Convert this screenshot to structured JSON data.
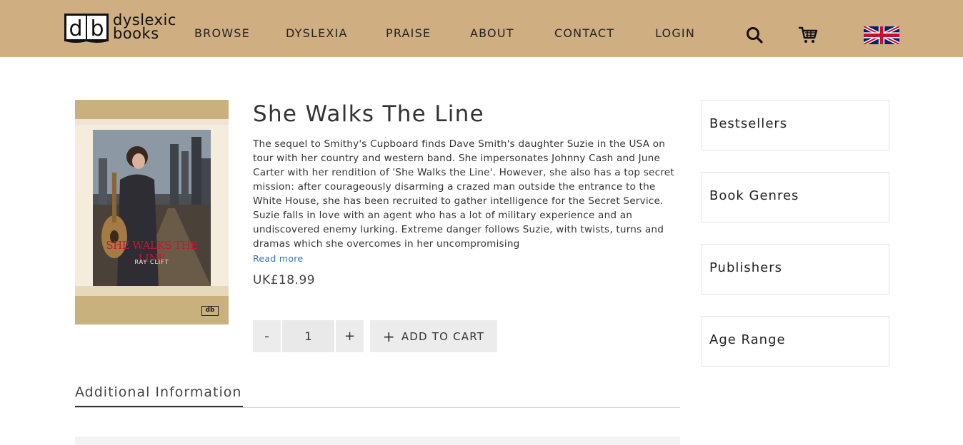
{
  "brand": {
    "mark": "db",
    "line1": "dyslexic",
    "line2": "books"
  },
  "nav": [
    {
      "label": "BROWSE"
    },
    {
      "label": "DYSLEXIA"
    },
    {
      "label": "PRAISE"
    },
    {
      "label": "ABOUT"
    },
    {
      "label": "CONTACT"
    },
    {
      "label": "LOGIN"
    }
  ],
  "header_icons": {
    "search": "search-icon",
    "cart": "cart-icon",
    "language": "uk-flag-icon"
  },
  "colors": {
    "header_bg": "#cfae82",
    "link": "#3a73a8",
    "cover_title": "#c3192d"
  },
  "product": {
    "cover": {
      "title": "SHE WALKS THE LINE",
      "author": "RAY CLIFT",
      "logo": "db"
    },
    "title": "She Walks The Line",
    "description": "The sequel to Smithy's Cupboard finds Dave Smith's daughter Suzie in the USA on tour with her country and western band. She impersonates Johnny Cash and June Carter with her rendition of 'She Walks the Line'. However, she also has a top secret mission: after courageously disarming a crazed man outside the entrance to the White House, she has been recruited to gather intelligence for the Secret Service. Suzie falls in love with an agent who has a lot of military experience and an undiscovered enemy lurking. Extreme danger follows Suzie, with twists, turns and dramas which she overcomes in her uncompromising",
    "read_more": "Read more",
    "price": "UK£18.99",
    "quantity": "1",
    "minus": "-",
    "plus": "+",
    "add_to_cart": "ADD TO CART"
  },
  "tabs": [
    {
      "label": "Additional Information"
    }
  ],
  "sidebar": [
    {
      "label": "Bestsellers"
    },
    {
      "label": "Book Genres"
    },
    {
      "label": "Publishers"
    },
    {
      "label": "Age Range"
    }
  ]
}
